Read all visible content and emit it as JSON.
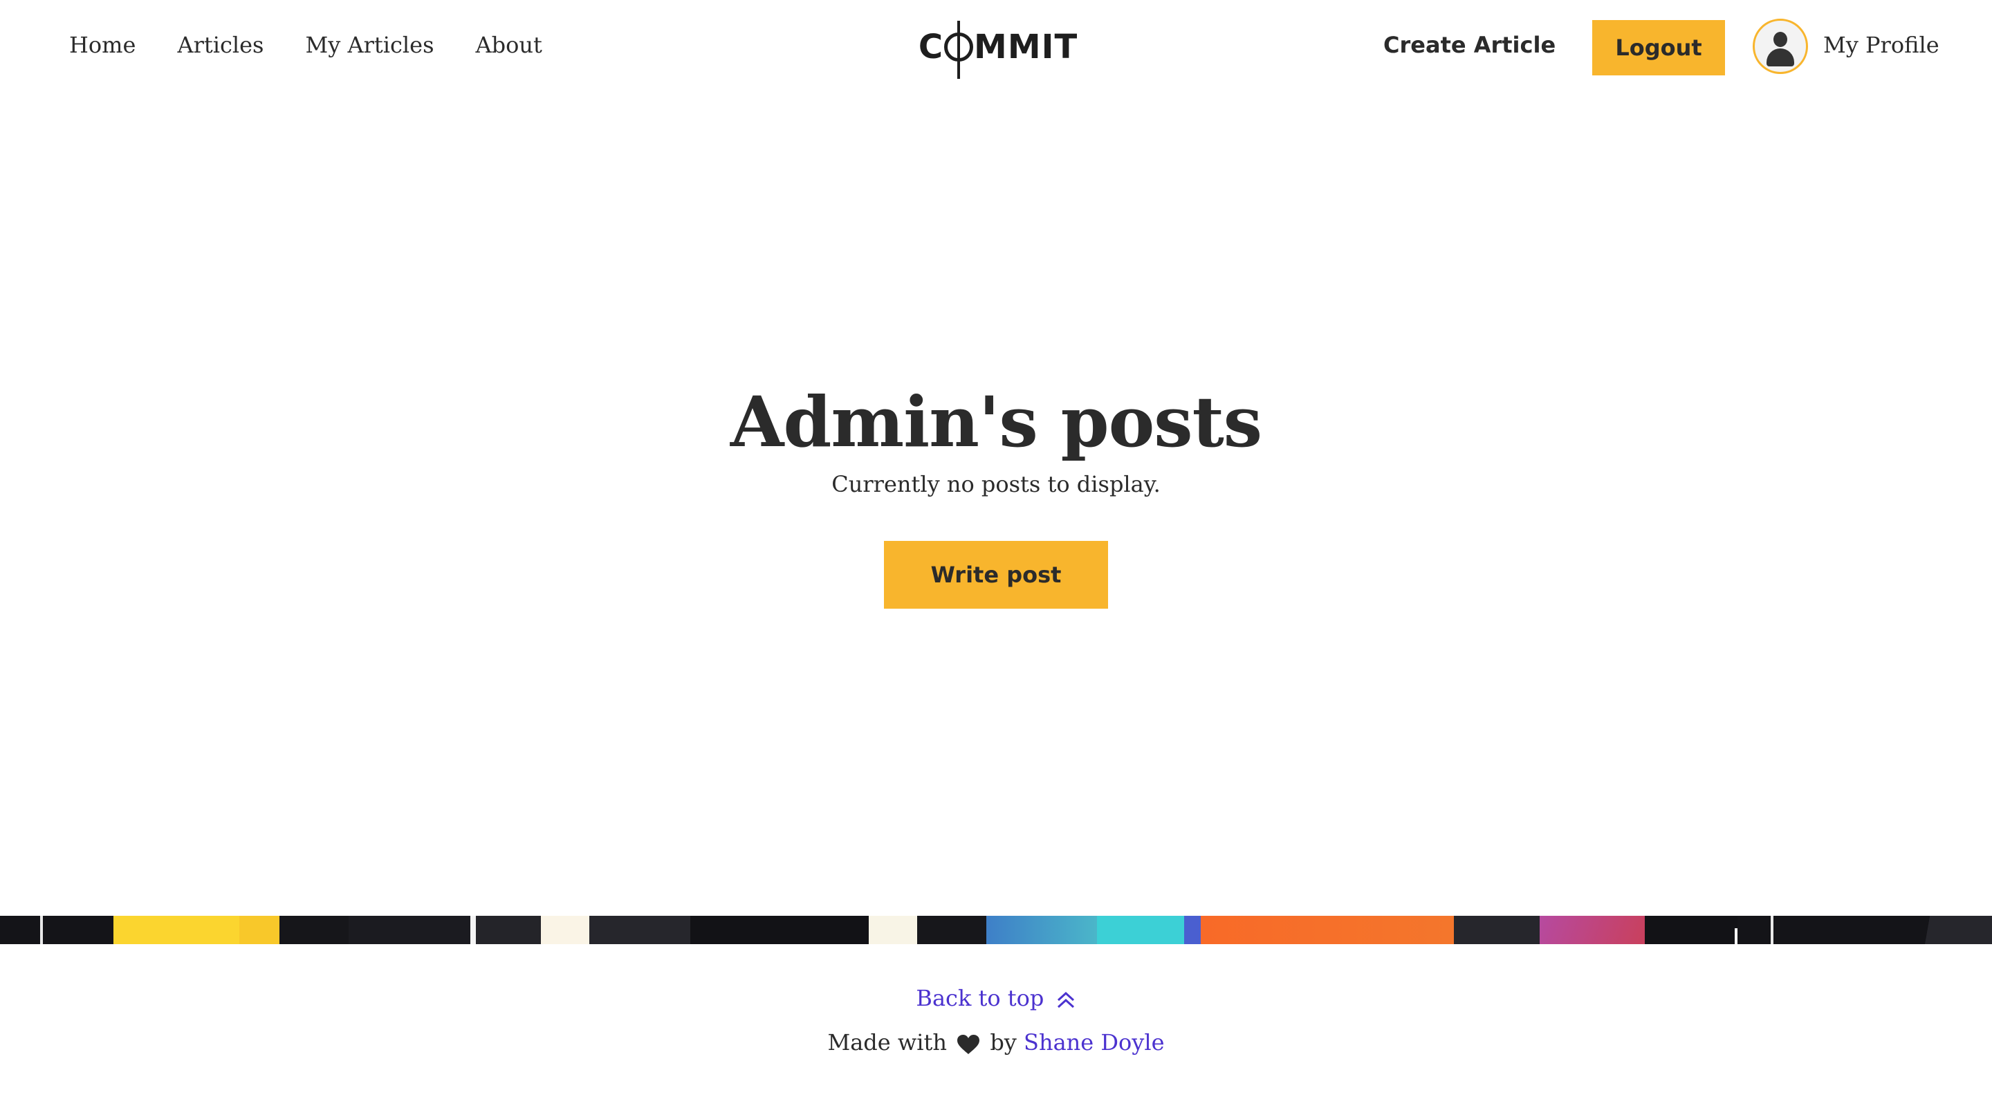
{
  "nav": {
    "links": [
      "Home",
      "Articles",
      "My Articles",
      "About"
    ],
    "logo": {
      "pre": "C",
      "post": "MMIT"
    },
    "create_article": "Create Article",
    "logout": "Logout",
    "profile": "My Profile",
    "avatar_icon": "user-icon"
  },
  "main": {
    "title": "Admin's posts",
    "empty_message": "Currently no posts to display.",
    "write_button": "Write post"
  },
  "footer": {
    "back_to_top": "Back to top",
    "back_to_top_icon": "double-chevron-up-icon",
    "made_with": "Made with",
    "heart_icon": "heart-icon",
    "by": "by",
    "author": "Shane Doyle"
  },
  "colors": {
    "accent": "#f8b52d",
    "link": "#4b32cf",
    "text": "#2b2b2b"
  }
}
